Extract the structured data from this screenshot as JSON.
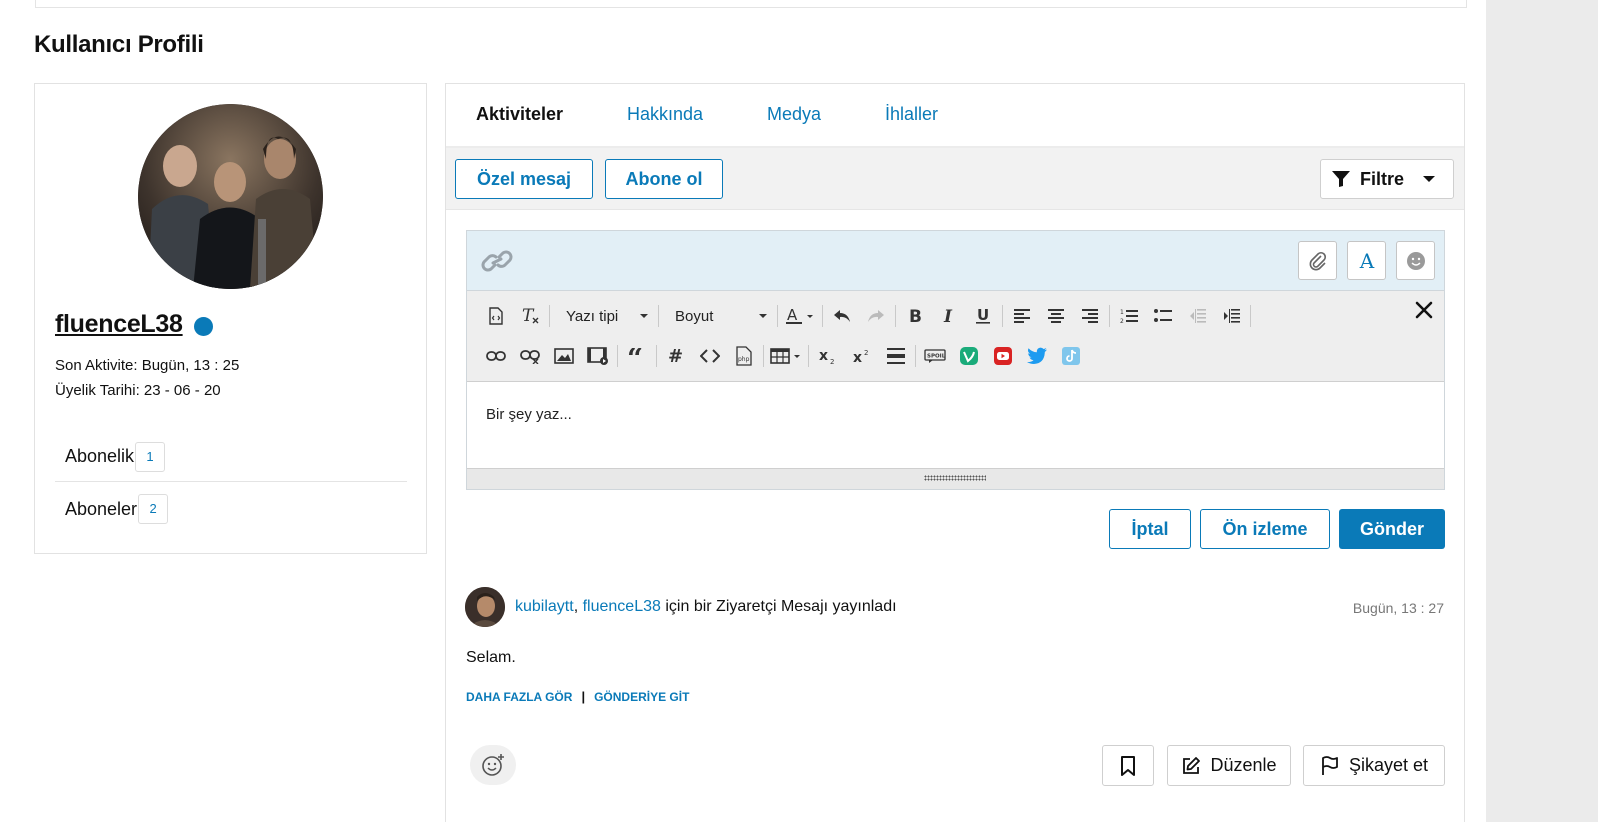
{
  "page": {
    "title": "Kullanıcı Profili"
  },
  "profile": {
    "username": "fluenceL38",
    "last_activity": "Son Aktivite: Bugün, 13 : 25",
    "member_since": "Üyelik Tarihi: 23 - 06 - 20",
    "stats": [
      {
        "label": "Abonelik",
        "count": "1"
      },
      {
        "label": "Aboneler",
        "count": "2"
      }
    ],
    "status_color": "#0a7ab8"
  },
  "tabs": [
    {
      "label": "Aktiviteler",
      "active": true
    },
    {
      "label": "Hakkında",
      "active": false
    },
    {
      "label": "Medya",
      "active": false
    },
    {
      "label": "İhlaller",
      "active": false
    }
  ],
  "actions": {
    "private_message": "Özel mesaj",
    "subscribe": "Abone ol",
    "filter": "Filtre"
  },
  "editor": {
    "font_select": "Yazı tipi",
    "size_select": "Boyut",
    "placeholder": "Bir şey yaz...",
    "top_icons": [
      "link-icon",
      "attachment-icon",
      "font-style-icon",
      "emoji-icon"
    ],
    "toolbar_row1": [
      "source-icon",
      "remove-format-icon",
      "font-color-icon",
      "undo-icon",
      "redo-icon",
      "bold-icon",
      "italic-icon",
      "underline-icon",
      "align-left-icon",
      "align-center-icon",
      "align-right-icon",
      "ordered-list-icon",
      "unordered-list-icon",
      "outdent-icon",
      "indent-icon",
      "close-icon"
    ],
    "toolbar_row2": [
      "link-icon",
      "unlink-icon",
      "image-icon",
      "media-icon",
      "quote-icon",
      "hashtag-icon",
      "code-icon",
      "php-icon",
      "table-icon",
      "subscript-icon",
      "superscript-icon",
      "horizontal-rule-icon",
      "spoiler-icon",
      "vine-icon",
      "youtube-icon",
      "twitter-icon",
      "tiktok-icon"
    ],
    "cancel": "İptal",
    "preview": "Ön izleme",
    "send": "Gönder"
  },
  "post": {
    "author": "kubilaytt",
    "separator": ",",
    "target": "fluenceL38",
    "action": "için bir Ziyaretçi Mesajı yayınladı",
    "time": "Bugün, 13 : 27",
    "body": "Selam.",
    "see_more": "DAHA FAZLA GÖR",
    "pipe": "|",
    "go_to_post": "GÖNDERİYE GİT",
    "edit": "Düzenle",
    "report": "Şikayet et"
  },
  "colors": {
    "accent": "#0a7ab8",
    "editor_header": "#e2eff6"
  }
}
